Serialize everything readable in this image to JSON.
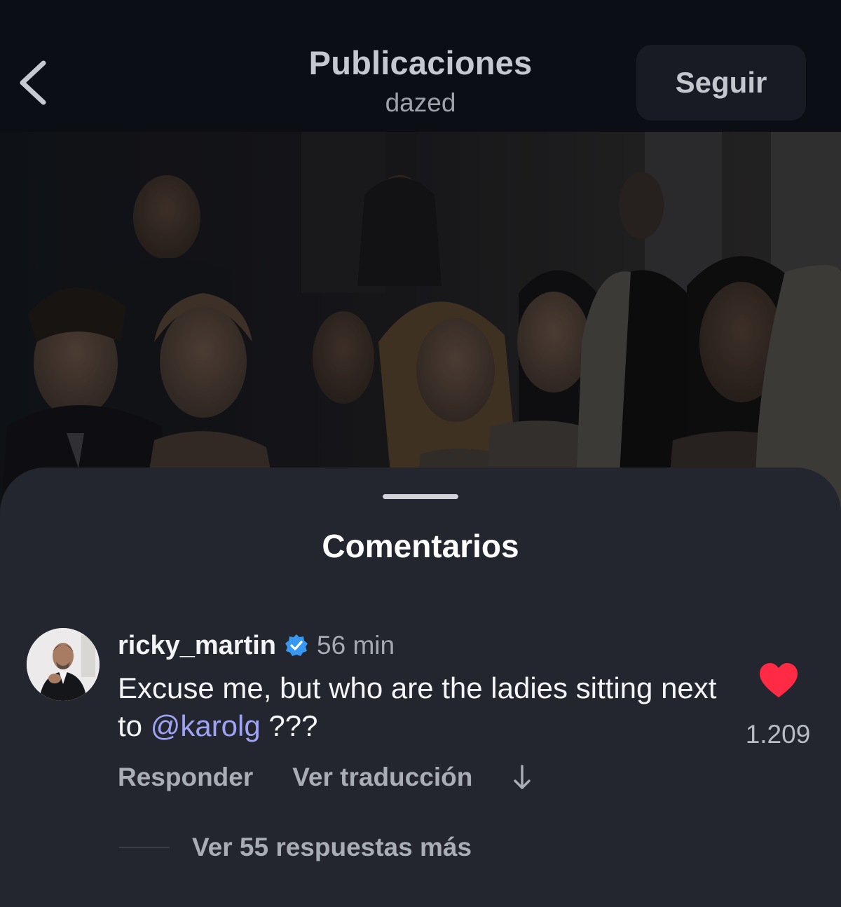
{
  "header": {
    "title": "Publicaciones",
    "subtitle": "dazed",
    "follow_label": "Seguir"
  },
  "post": {
    "image_icon": "photo"
  },
  "comments_sheet": {
    "title": "Comentarios",
    "comment": {
      "username": "ricky_martin",
      "verified": true,
      "time": "56 min",
      "text_before_mention": "Excuse me, but who are the ladies sitting next to ",
      "mention": "@karolg",
      "text_after_mention": " ???",
      "likes": "1.209",
      "liked": true,
      "reply_label": "Responder",
      "translate_label": "Ver traducción",
      "view_replies_label": "Ver 55 respuestas más"
    }
  },
  "colors": {
    "background": "#0c0f16",
    "sheet": "#23262e",
    "mention": "#9fa3f5",
    "heart": "#ff2b45",
    "verified": "#3897f0"
  }
}
